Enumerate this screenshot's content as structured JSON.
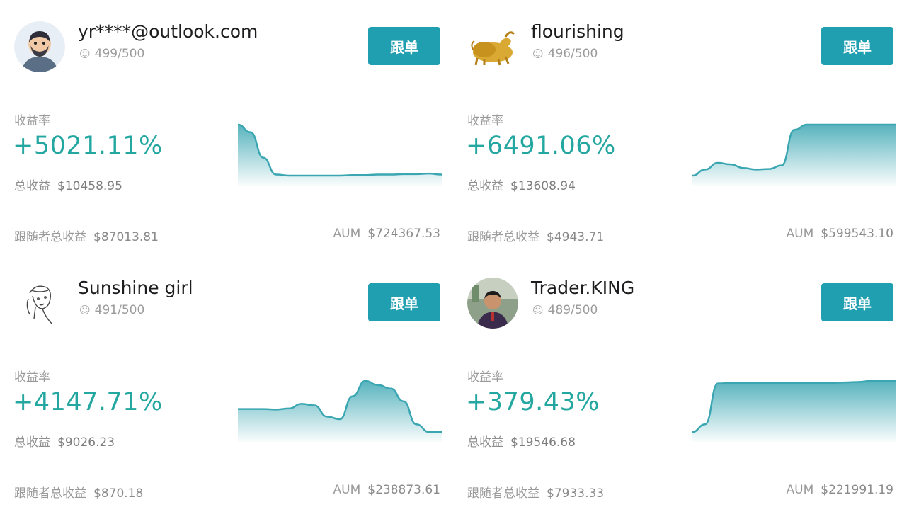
{
  "labels": {
    "follow_button": "跟单",
    "rate_label": "收益率",
    "total_label": "总收益",
    "follower_label": "跟随者总收益",
    "aum_label": "AUM"
  },
  "colors": {
    "accent": "#1f9fb0",
    "rate_green": "#23a7a0",
    "chart_line": "#3aa6b2"
  },
  "traders": [
    {
      "name": "yr****@outlook.com",
      "seat_icon": "users-icon",
      "seats": "499/500",
      "rate": "+5021.11%",
      "total": "$10458.95",
      "follower_total": "$87013.81",
      "aum": "$724367.53",
      "avatar": "bearded-man-avatar",
      "sparkline": [
        1.0,
        0.85,
        0.35,
        0.02,
        0.0,
        0.0,
        0.0,
        0.0,
        0.0,
        0.01,
        0.01,
        0.02,
        0.02,
        0.03,
        0.03,
        0.04,
        0.02
      ]
    },
    {
      "name": "flourishing",
      "seat_icon": "users-icon",
      "seats": "496/500",
      "rate": "+6491.06%",
      "total": "$13608.94",
      "follower_total": "$4943.71",
      "aum": "$599543.10",
      "avatar": "golden-bull-avatar",
      "sparkline": [
        0.0,
        0.12,
        0.25,
        0.22,
        0.15,
        0.12,
        0.13,
        0.2,
        0.9,
        1.0,
        1.0,
        1.0,
        1.0,
        1.0,
        1.0,
        1.0,
        1.0
      ]
    },
    {
      "name": "Sunshine girl",
      "seat_icon": "users-icon",
      "seats": "491/500",
      "rate": "+4147.71%",
      "total": "$9026.23",
      "follower_total": "$870.18",
      "aum": "$238873.61",
      "avatar": "sketch-girl-avatar",
      "sparkline": [
        0.45,
        0.45,
        0.45,
        0.44,
        0.46,
        0.55,
        0.52,
        0.3,
        0.25,
        0.7,
        1.0,
        0.92,
        0.85,
        0.6,
        0.15,
        0.0,
        0.0
      ]
    },
    {
      "name": "Trader.KING",
      "seat_icon": "users-icon",
      "seats": "489/500",
      "rate": "+379.43%",
      "total": "$19546.68",
      "follower_total": "$7933.33",
      "aum": "$221991.19",
      "avatar": "man-photo-avatar",
      "sparkline": [
        0.0,
        0.15,
        0.95,
        0.96,
        0.96,
        0.96,
        0.96,
        0.96,
        0.96,
        0.96,
        0.96,
        0.96,
        0.97,
        0.98,
        1.0,
        1.0,
        1.0
      ]
    }
  ]
}
